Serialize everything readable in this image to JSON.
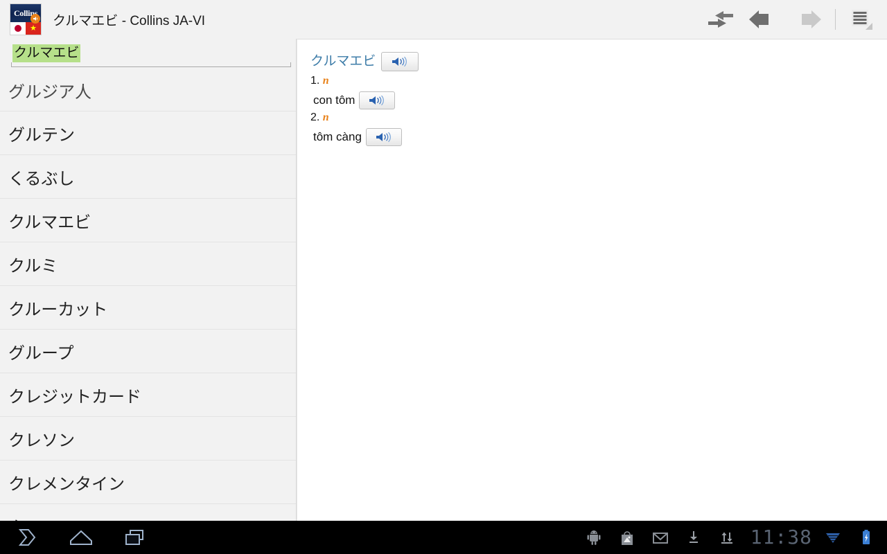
{
  "window": {
    "title": "クルマエビ - Collins JA-VI",
    "app_icon_name": "collins-ja-vi-icon",
    "logo_text": "Collins",
    "flag_vn_star": "★"
  },
  "toolbar": {
    "swap_label": "swap-languages",
    "back_label": "back",
    "forward_label": "forward",
    "menu_label": "menu"
  },
  "search": {
    "value": "クルマエビ",
    "placeholder": "クルマエビ",
    "selection_color": "#b6e08a"
  },
  "wordlist": {
    "items": [
      {
        "label": "グルジア人"
      },
      {
        "label": "グルテン"
      },
      {
        "label": "くるぶし"
      },
      {
        "label": "クルマエビ"
      },
      {
        "label": "クルミ"
      },
      {
        "label": "クルーカット"
      },
      {
        "label": "グループ"
      },
      {
        "label": "クレジットカード"
      },
      {
        "label": "クレソン"
      },
      {
        "label": "クレメンタイン"
      },
      {
        "label": "クレヨン"
      }
    ]
  },
  "entry": {
    "headword": "クルマエビ",
    "headword_color": "#3d7ca8",
    "speak_button_label": "speaker-icon",
    "senses": [
      {
        "number": "1.",
        "pos": "n",
        "translation": "con tôm"
      },
      {
        "number": "2.",
        "pos": "n",
        "translation": "tôm càng"
      }
    ],
    "pos_color": "#e8821a"
  },
  "system": {
    "nav": {
      "back": "back-nav",
      "home": "home-nav",
      "recents": "recents-nav"
    },
    "status_icons": [
      "android-robot-icon",
      "play-store-icon",
      "gmail-icon",
      "download-icon",
      "sync-icon"
    ],
    "clock": "11:38",
    "wifi": "wifi-icon",
    "battery": "battery-charging-icon",
    "accent_color": "#3b7fd4"
  }
}
